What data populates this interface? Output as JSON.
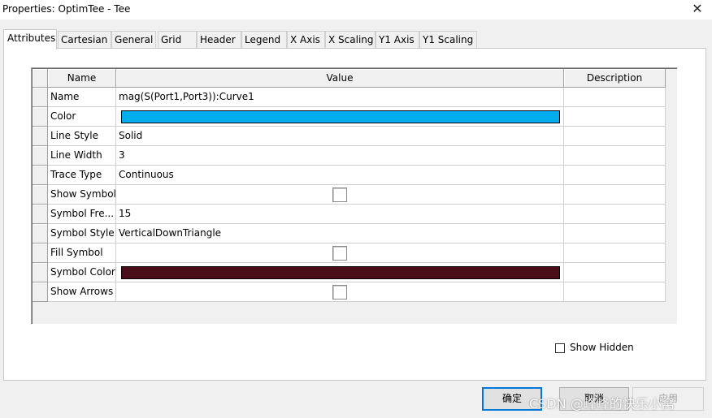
{
  "window": {
    "title": "Properties: OptimTee - Tee",
    "close_glyph": "✕"
  },
  "tabs": [
    {
      "label": "Attributes",
      "active": true
    },
    {
      "label": "Cartesian"
    },
    {
      "label": "General"
    },
    {
      "label": "Grid"
    },
    {
      "label": "Header"
    },
    {
      "label": "Legend"
    },
    {
      "label": "X Axis"
    },
    {
      "label": "X Scaling"
    },
    {
      "label": "Y1 Axis"
    },
    {
      "label": "Y1 Scaling"
    }
  ],
  "grid": {
    "headers": {
      "name": "Name",
      "value": "Value",
      "description": "Description"
    },
    "rows": [
      {
        "name": "Name",
        "value": "mag(S(Port1,Port3)):Curve1",
        "type": "text"
      },
      {
        "name": "Color",
        "value": "#00aeef",
        "type": "color"
      },
      {
        "name": "Line Style",
        "value": "Solid",
        "type": "text"
      },
      {
        "name": "Line Width",
        "value": "3",
        "type": "text"
      },
      {
        "name": "Trace Type",
        "value": "Continuous",
        "type": "text"
      },
      {
        "name": "Show Symbol",
        "value": false,
        "type": "checkbox"
      },
      {
        "name": "Symbol Fre...",
        "value": "15",
        "type": "text"
      },
      {
        "name": "Symbol Style",
        "value": "VerticalDownTriangle",
        "type": "text"
      },
      {
        "name": "Fill Symbol",
        "value": false,
        "type": "checkbox"
      },
      {
        "name": "Symbol Color",
        "value": "#4a0e18",
        "type": "color"
      },
      {
        "name": "Show Arrows",
        "value": false,
        "type": "checkbox"
      }
    ]
  },
  "show_hidden": {
    "label": "Show Hidden",
    "checked": false
  },
  "buttons": {
    "ok": "确定",
    "cancel": "取消",
    "apply": "应用"
  },
  "watermark": "CSDN @峰峰的快乐小窝"
}
